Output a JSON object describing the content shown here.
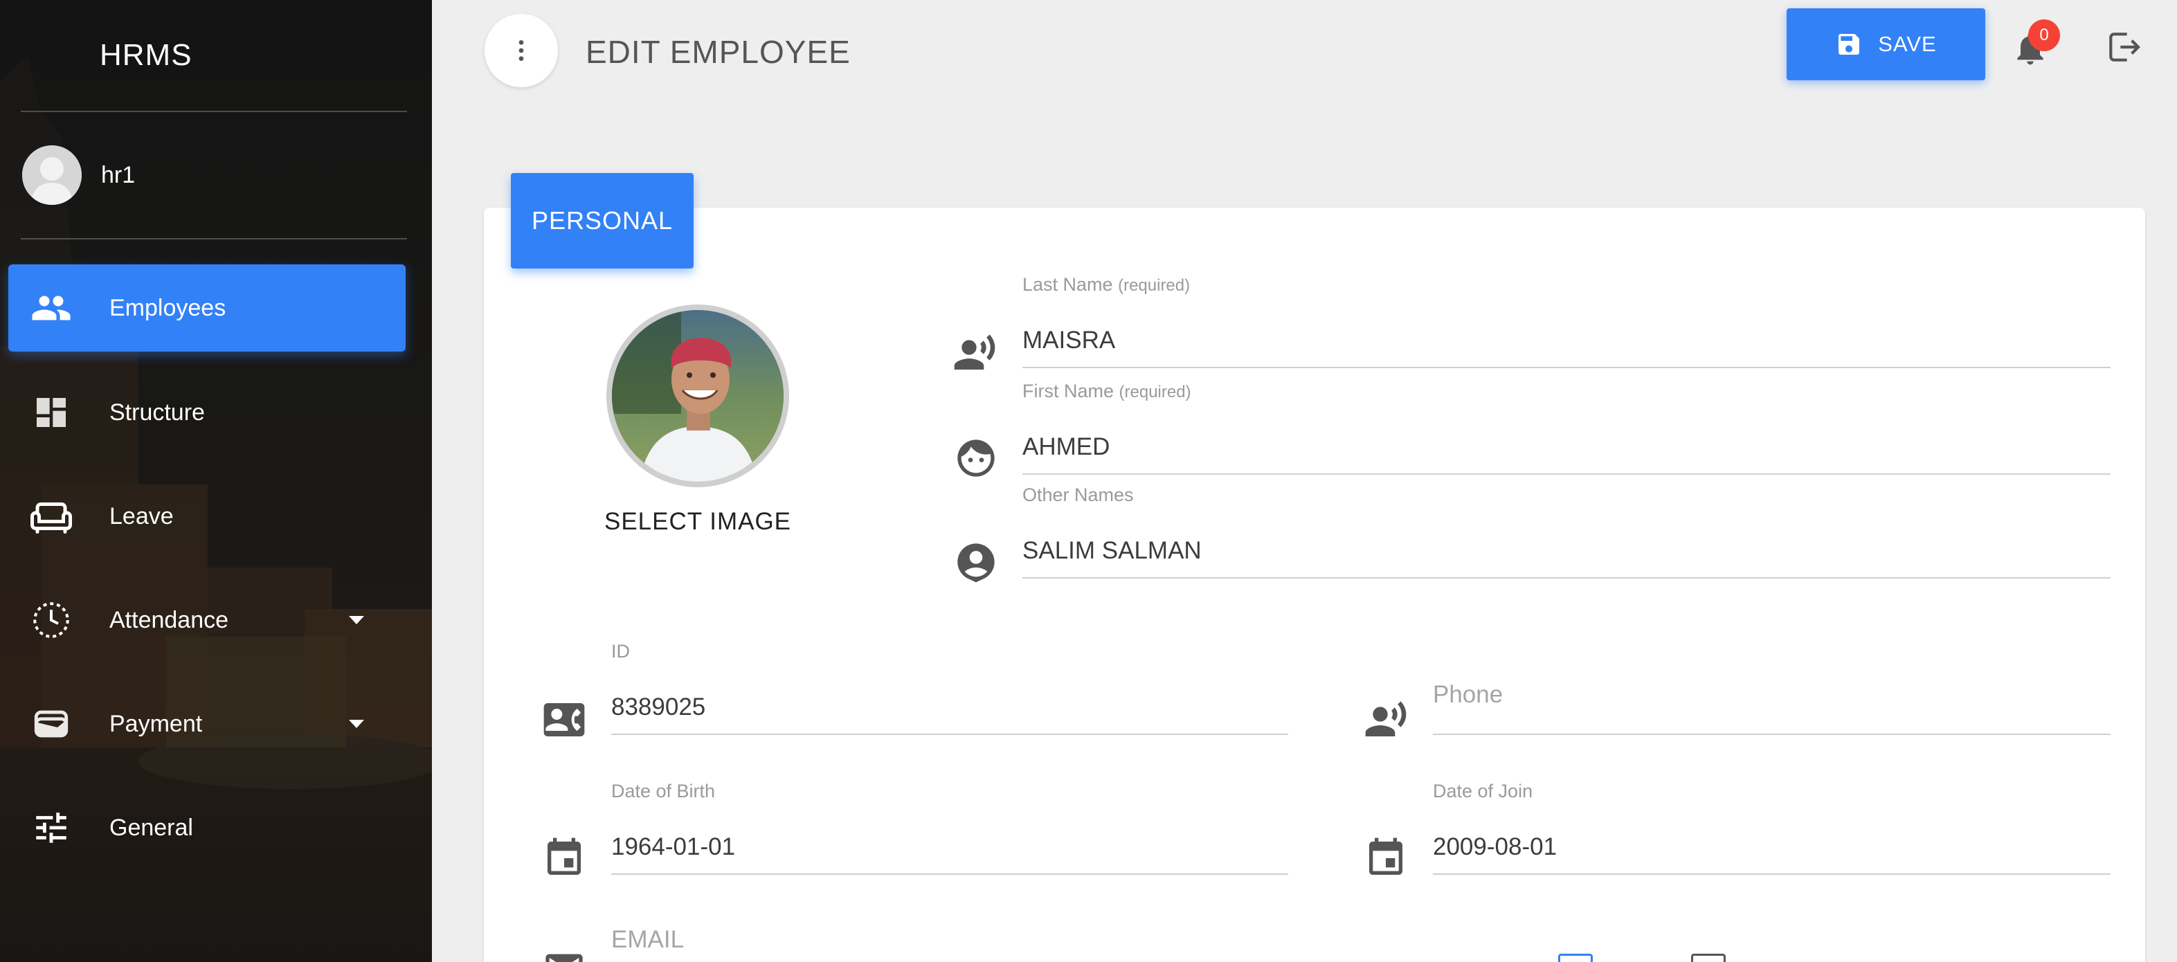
{
  "app": {
    "brand": "HRMS"
  },
  "user": {
    "name": "hr1"
  },
  "sidebar": {
    "items": [
      {
        "label": "Employees",
        "icon": "people-icon",
        "active": true,
        "has_caret": false
      },
      {
        "label": "Structure",
        "icon": "dashboard-icon",
        "active": false,
        "has_caret": false
      },
      {
        "label": "Leave",
        "icon": "sofa-icon",
        "active": false,
        "has_caret": false
      },
      {
        "label": "Attendance",
        "icon": "clock-icon",
        "active": false,
        "has_caret": true
      },
      {
        "label": "Payment",
        "icon": "wallet-icon",
        "active": false,
        "has_caret": true
      },
      {
        "label": "General",
        "icon": "tune-icon",
        "active": false,
        "has_caret": false
      }
    ]
  },
  "header": {
    "title": "EDIT EMPLOYEE",
    "save_label": "SAVE",
    "notification_count": "0"
  },
  "tabs": {
    "personal": "PERSONAL"
  },
  "photo": {
    "select_label": "SELECT IMAGE"
  },
  "form": {
    "last_name": {
      "label": "Last Name",
      "required": "(required)",
      "value": "MAISRA"
    },
    "first_name": {
      "label": "First Name",
      "required": "(required)",
      "value": "AHMED"
    },
    "other_names": {
      "label": "Other Names",
      "value": "SALIM SALMAN"
    },
    "id": {
      "label": "ID",
      "value": "8389025"
    },
    "phone": {
      "placeholder": "Phone"
    },
    "dob": {
      "label": "Date of Birth",
      "value": "1964-01-01"
    },
    "doj": {
      "label": "Date of Join",
      "value": "2009-08-01"
    },
    "email": {
      "placeholder": "EMAIL"
    }
  },
  "colors": {
    "accent": "#3381f7",
    "badge": "#f44336",
    "background": "#eeeeee"
  }
}
